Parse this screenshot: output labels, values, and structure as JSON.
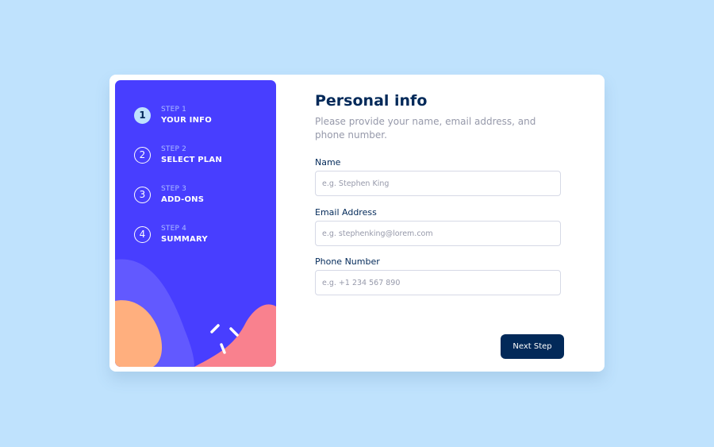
{
  "colors": {
    "page_background": "#bfe2fd",
    "sidebar_background": "#483eff",
    "accent_dark": "#022959",
    "active_step_fill": "#bfe2fd",
    "muted_text": "#9699aa",
    "decor_orange": "#ffaf7e",
    "decor_pink": "#f9818e",
    "decor_purple": "#6259ff"
  },
  "sidebar": {
    "steps": [
      {
        "number": "1",
        "label": "STEP 1",
        "name": "YOUR INFO",
        "active": true
      },
      {
        "number": "2",
        "label": "STEP 2",
        "name": "SELECT PLAN",
        "active": false
      },
      {
        "number": "3",
        "label": "STEP 3",
        "name": "ADD-ONS",
        "active": false
      },
      {
        "number": "4",
        "label": "STEP 4",
        "name": "SUMMARY",
        "active": false
      }
    ]
  },
  "form": {
    "title": "Personal info",
    "subtitle": "Please provide your name, email address, and phone number.",
    "fields": [
      {
        "label": "Name",
        "placeholder": "e.g. Stephen King",
        "value": ""
      },
      {
        "label": "Email Address",
        "placeholder": "e.g. stephenking@lorem.com",
        "value": ""
      },
      {
        "label": "Phone Number",
        "placeholder": "e.g. +1 234 567 890",
        "value": ""
      }
    ],
    "next_label": "Next Step"
  }
}
